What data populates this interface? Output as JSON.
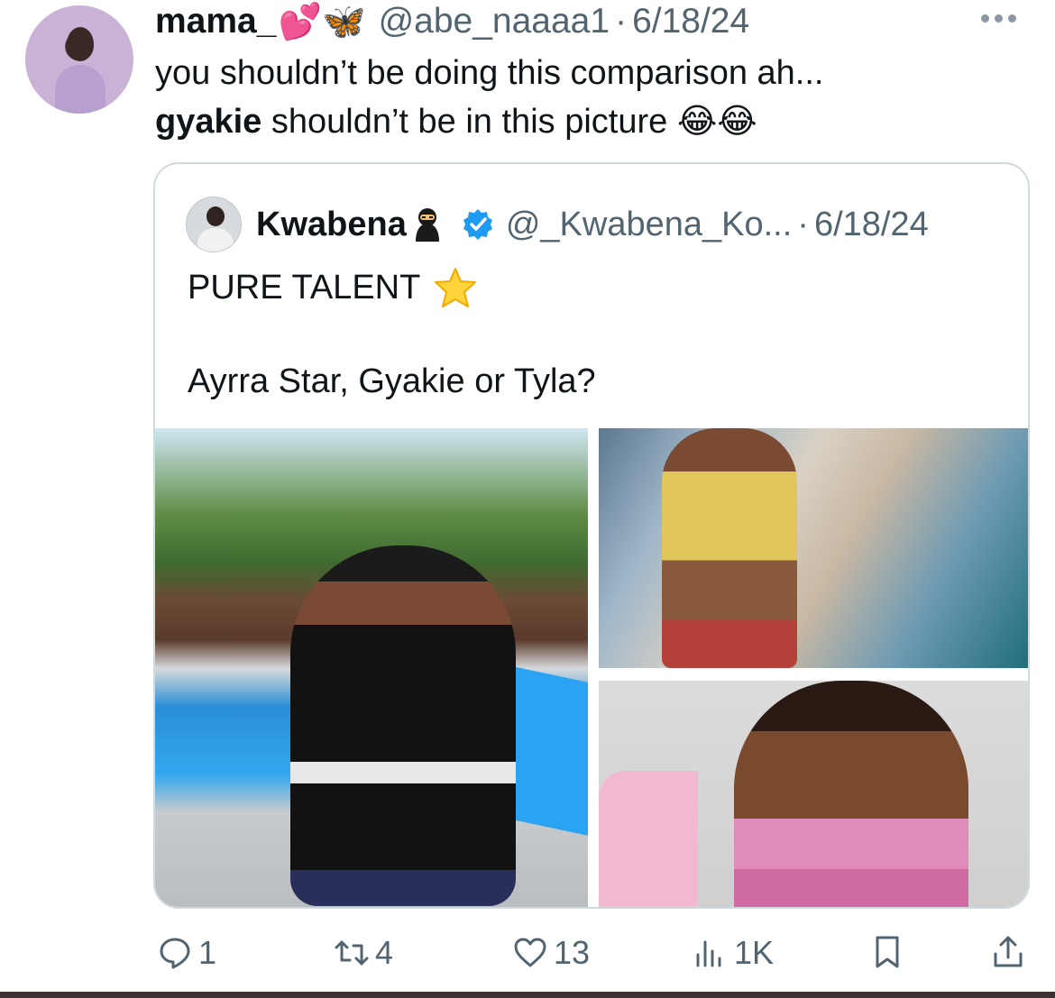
{
  "tweet": {
    "author_name": "mama_",
    "author_emojis": "💕🦋",
    "handle": "@abe_naaaa1",
    "date": "6/18/24",
    "line1": "you shouldn’t be doing this comparison ah...",
    "line2_bold": "gyakie",
    "line2_rest": " shouldn’t be in this picture",
    "line2_emojis": "😂😂",
    "more_icon": "more-horizontal-icon"
  },
  "quote": {
    "author_name": "Kwabena",
    "author_emoji": "🥷",
    "verified": true,
    "handle": "@_Kwabena_Ko...",
    "date": "6/18/24",
    "line1": "PURE TALENT",
    "line1_emoji": "⭐",
    "line2": "Ayrra Star, Gyakie or Tyla?"
  },
  "actions": {
    "reply_count": "1",
    "retweet_count": "4",
    "like_count": "13",
    "views_count": "1K",
    "icons": [
      "reply-icon",
      "retweet-icon",
      "like-icon",
      "views-icon",
      "bookmark-icon",
      "share-icon"
    ]
  },
  "colors": {
    "text": "#0f1419",
    "secondary": "#536471",
    "verified": "#1d9bf0",
    "border": "#cfd9de"
  }
}
